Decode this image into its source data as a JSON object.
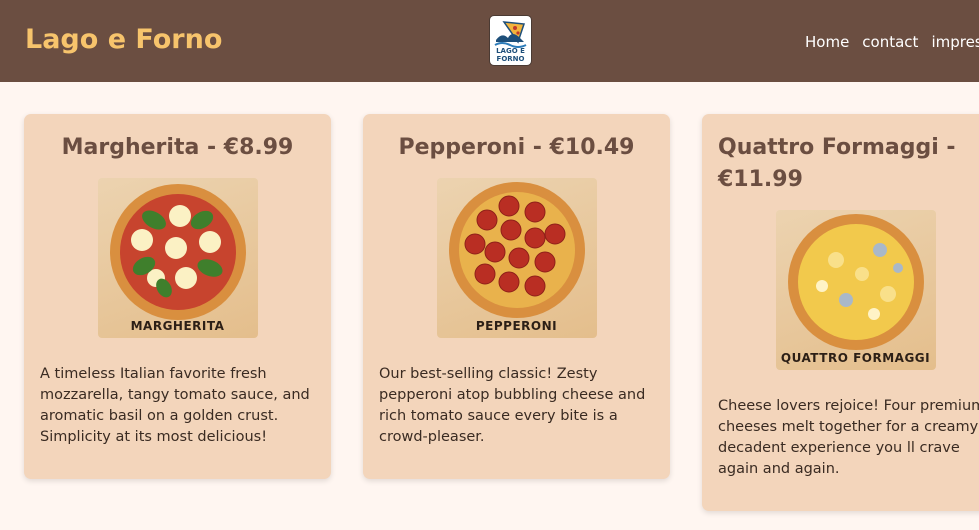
{
  "header": {
    "brand": "Lago e Forno",
    "logo_text": [
      "LAGO E",
      "FORNO"
    ],
    "nav": [
      {
        "label": "Home"
      },
      {
        "label": "contact"
      },
      {
        "label": "impres"
      }
    ]
  },
  "cards": [
    {
      "title": "Margherita - €8.99",
      "image_caption": "MARGHERITA",
      "description": "A timeless Italian favorite fresh mozzarella, tangy tomato sauce, and aromatic basil on a golden crust. Simplicity at its most delicious!"
    },
    {
      "title": "Pepperoni - €10.49",
      "image_caption": "PEPPERONI",
      "description": "Our best-selling classic! Zesty pepperoni atop bubbling cheese and rich tomato sauce every bite is a crowd-pleaser."
    },
    {
      "title": "Quattro Formaggi - €11.99",
      "image_caption": "QUATTRO FORMAGGI",
      "description": "Cheese lovers rejoice! Four premium cheeses melt together for a creamy, decadent experience you ll crave again and again."
    }
  ],
  "colors": {
    "header_bg": "#6b4e41",
    "brand": "#f7c46c",
    "card_bg": "#f3d5bb",
    "page_bg": "#fff6f1"
  }
}
